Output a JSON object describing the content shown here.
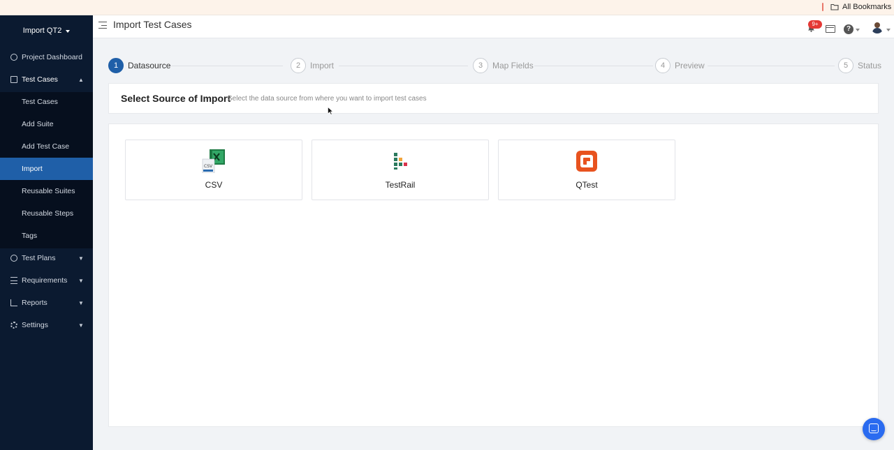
{
  "bookmarks_bar": {
    "all_bookmarks": "All Bookmarks"
  },
  "sidebar": {
    "project": "Import QT2",
    "items": [
      {
        "label": "Project Dashboard",
        "icon": "dashboard-icon"
      },
      {
        "label": "Test Cases",
        "icon": "edit-icon",
        "expanded": true
      },
      {
        "label": "Test Plans",
        "icon": "check-circle-icon"
      },
      {
        "label": "Requirements",
        "icon": "list-icon"
      },
      {
        "label": "Reports",
        "icon": "chart-icon"
      },
      {
        "label": "Settings",
        "icon": "gear-icon"
      }
    ],
    "sub_items": [
      {
        "label": "Test Cases"
      },
      {
        "label": "Add Suite"
      },
      {
        "label": "Add Test Case"
      },
      {
        "label": "Import",
        "active": true
      },
      {
        "label": "Reusable Suites"
      },
      {
        "label": "Reusable Steps"
      },
      {
        "label": "Tags"
      }
    ]
  },
  "header": {
    "title": "Import Test Cases",
    "notification_badge": "9+"
  },
  "stepper": {
    "steps": [
      {
        "num": "1",
        "label": "Datasource",
        "active": true
      },
      {
        "num": "2",
        "label": "Import"
      },
      {
        "num": "3",
        "label": "Map Fields"
      },
      {
        "num": "4",
        "label": "Preview"
      },
      {
        "num": "5",
        "label": "Status"
      }
    ]
  },
  "source_panel": {
    "title": "Select Source of Import",
    "subtitle": "Select the data source from where you want to import test cases"
  },
  "sources": [
    {
      "label": "CSV",
      "icon": "csv-file-icon"
    },
    {
      "label": "TestRail",
      "icon": "testrail-logo-icon"
    },
    {
      "label": "QTest",
      "icon": "qtest-logo-icon"
    }
  ],
  "colors": {
    "sidebar_bg": "#0b1a30",
    "accent": "#1f5fa8",
    "badge": "#e53935",
    "qtest_orange": "#e8531f",
    "chat": "#2a6bf0"
  }
}
